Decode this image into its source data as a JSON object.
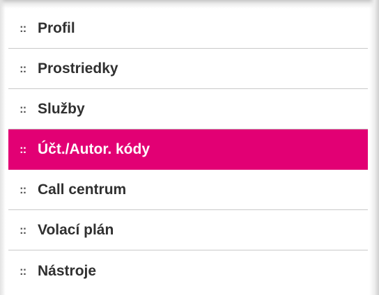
{
  "menu": {
    "items": [
      {
        "label": "Profil",
        "bullet": "::",
        "active": false
      },
      {
        "label": "Prostriedky",
        "bullet": "::",
        "active": false
      },
      {
        "label": "Služby",
        "bullet": "::",
        "active": false
      },
      {
        "label": "Účt./Autor. kódy",
        "bullet": "::",
        "active": true
      },
      {
        "label": "Call centrum",
        "bullet": "::",
        "active": false
      },
      {
        "label": "Volací plán",
        "bullet": "::",
        "active": false
      },
      {
        "label": "Nástroje",
        "bullet": "::",
        "active": false
      }
    ]
  },
  "colors": {
    "active_background": "#e20074",
    "active_text": "#ffffff",
    "text": "#303030",
    "divider": "#c9c9c9"
  }
}
